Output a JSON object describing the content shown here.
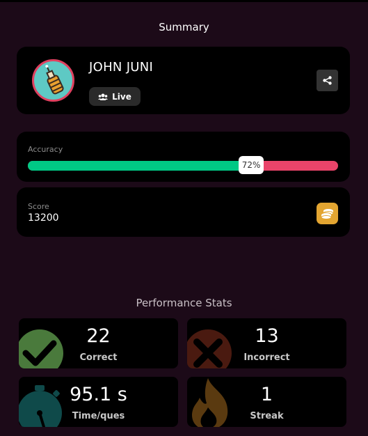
{
  "header": {
    "title": "Summary"
  },
  "profile": {
    "name": "JOHN JUNI",
    "status_label": "Live",
    "avatar_icon": "potion-bottle-icon",
    "share_icon": "share-icon"
  },
  "accuracy": {
    "label": "Accuracy",
    "value_text": "72%",
    "fraction": 0.72,
    "colors": {
      "correct": "#00c985",
      "incorrect": "#e9446a"
    }
  },
  "score": {
    "label": "Score",
    "value": "13200",
    "icon": "coins-icon"
  },
  "performance": {
    "title": "Performance Stats",
    "stats": [
      {
        "value": "22",
        "label": "Correct",
        "icon": "checkmark-icon",
        "color": "#4a7a3c"
      },
      {
        "value": "13",
        "label": "Incorrect",
        "icon": "cross-icon",
        "color": "#4a1a10"
      },
      {
        "value": "95.1 s",
        "label": "Time/ques",
        "icon": "stopwatch-icon",
        "color": "#0f4a4a"
      },
      {
        "value": "1",
        "label": "Streak",
        "icon": "flame-icon",
        "color": "#5a3a10"
      }
    ]
  }
}
